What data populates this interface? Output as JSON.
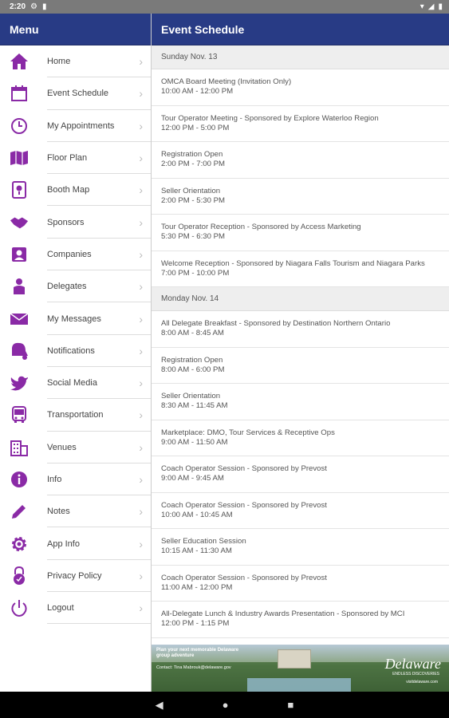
{
  "status": {
    "time": "2:20"
  },
  "colors": {
    "header": "#283b85",
    "icon": "#8a2aa6"
  },
  "sidebar": {
    "title": "Menu",
    "items": [
      {
        "label": "Home",
        "icon": "home-icon"
      },
      {
        "label": "Event Schedule",
        "icon": "calendar-icon"
      },
      {
        "label": "My Appointments",
        "icon": "clock-icon"
      },
      {
        "label": "Floor Plan",
        "icon": "map-icon"
      },
      {
        "label": "Booth Map",
        "icon": "booth-pin-icon"
      },
      {
        "label": "Sponsors",
        "icon": "handshake-icon"
      },
      {
        "label": "Companies",
        "icon": "contacts-icon"
      },
      {
        "label": "Delegates",
        "icon": "people-icon"
      },
      {
        "label": "My Messages",
        "icon": "mail-icon"
      },
      {
        "label": "Notifications",
        "icon": "bell-icon"
      },
      {
        "label": "Social Media",
        "icon": "bird-icon"
      },
      {
        "label": "Transportation",
        "icon": "bus-icon"
      },
      {
        "label": "Venues",
        "icon": "building-icon"
      },
      {
        "label": "Info",
        "icon": "info-icon"
      },
      {
        "label": "Notes",
        "icon": "pencil-icon"
      },
      {
        "label": "App Info",
        "icon": "gear-icon"
      },
      {
        "label": "Privacy Policy",
        "icon": "lock-icon"
      },
      {
        "label": "Logout",
        "icon": "power-icon"
      }
    ]
  },
  "main": {
    "title": "Event Schedule",
    "days": [
      {
        "label": "Sunday Nov. 13",
        "events": [
          {
            "title": "OMCA Board Meeting (Invitation Only)",
            "time": "10:00 AM - 12:00 PM"
          },
          {
            "title": "Tour Operator Meeting - Sponsored by Explore Waterloo Region",
            "time": "12:00 PM - 5:00 PM"
          },
          {
            "title": "Registration Open",
            "time": "2:00 PM - 7:00 PM"
          },
          {
            "title": "Seller Orientation",
            "time": "2:00 PM - 5:30 PM"
          },
          {
            "title": "Tour Operator Reception - Sponsored by Access Marketing",
            "time": "5:30 PM - 6:30 PM"
          },
          {
            "title": "Welcome Reception - Sponsored by Niagara Falls Tourism and Niagara Parks",
            "time": "7:00 PM - 10:00 PM"
          }
        ]
      },
      {
        "label": "Monday Nov. 14",
        "events": [
          {
            "title": "All Delegate Breakfast - Sponsored by Destination Northern Ontario",
            "time": "8:00 AM - 8:45 AM"
          },
          {
            "title": "Registration Open",
            "time": "8:00 AM - 6:00 PM"
          },
          {
            "title": "Seller Orientation",
            "time": "8:30 AM - 11:45 AM"
          },
          {
            "title": "Marketplace: DMO, Tour Services & Receptive Ops",
            "time": "9:00 AM - 11:50 AM"
          },
          {
            "title": "Coach Operator Session - Sponsored by Prevost",
            "time": "9:00 AM - 9:45 AM"
          },
          {
            "title": "Coach Operator Session - Sponsored by Prevost",
            "time": "10:00 AM - 10:45 AM"
          },
          {
            "title": "Seller Education Session",
            "time": "10:15 AM - 11:30 AM"
          },
          {
            "title": "Coach Operator Session - Sponsored by Prevost",
            "time": "11:00 AM - 12:00 PM"
          },
          {
            "title": "All-Delegate Lunch & Industry Awards Presentation - Sponsored by MCI",
            "time": "12:00 PM - 1:15 PM"
          }
        ]
      }
    ]
  },
  "banner": {
    "headline": "Plan your next memorable Delaware group adventure",
    "contact": "Contact: Tina Mabrouk@delaware.gov",
    "brand": "Delaware",
    "tagline": "ENDLESS DISCOVERIES",
    "url": "visitdelaware.com"
  }
}
